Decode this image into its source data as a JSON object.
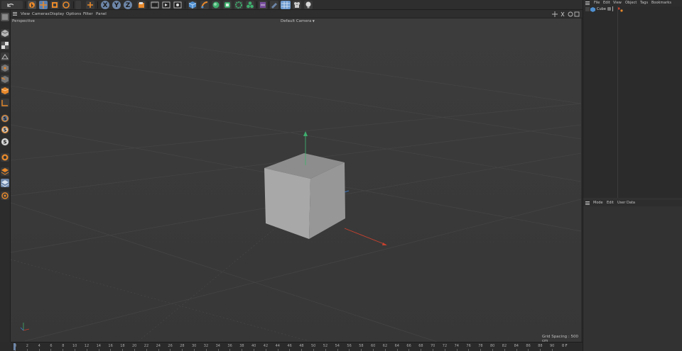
{
  "colors": {
    "accent_orange": "#e8892b",
    "axis_x": "#c8412e",
    "axis_y": "#3fae6e",
    "axis_z": "#3b7bd4",
    "cube_front": "#a8a8a8",
    "cube_top": "#8d8d8d",
    "cube_right": "#979797"
  },
  "toolbar": {
    "icons": [
      "undo-icon",
      "live-select-icon",
      "move-icon",
      "scale-icon",
      "rotate-icon",
      "add-icon",
      "x-axis-lock-icon",
      "y-axis-lock-icon",
      "z-axis-lock-icon",
      "world-coords-icon",
      "render-region-icon",
      "render-view-icon",
      "render-settings-icon",
      "cube-icon",
      "pen-icon",
      "subdivision-icon",
      "array-icon",
      "deformer-icon",
      "mograph-icon",
      "sky-icon",
      "camera-icon",
      "floor-icon",
      "render-pot-icon",
      "light-icon"
    ],
    "xyz": [
      "X",
      "Y",
      "Z"
    ]
  },
  "viewport": {
    "menus": [
      "View",
      "Cameras",
      "Display",
      "Options",
      "Filter",
      "Panel"
    ],
    "view_name": "Perspective",
    "camera": "Default Camera",
    "grid_spacing": "Grid Spacing : 500 cm"
  },
  "timeline": {
    "ticks": [
      "0",
      "2",
      "4",
      "6",
      "8",
      "10",
      "12",
      "14",
      "16",
      "18",
      "20",
      "22",
      "24",
      "26",
      "28",
      "30",
      "32",
      "34",
      "36",
      "38",
      "40",
      "42",
      "44",
      "46",
      "48",
      "50",
      "52",
      "54",
      "56",
      "58",
      "60",
      "62",
      "64",
      "66",
      "68",
      "70",
      "72",
      "74",
      "76",
      "78",
      "80",
      "82",
      "84",
      "86",
      "88",
      "90"
    ],
    "current_frame": "0 F"
  },
  "object_manager": {
    "menus": [
      "File",
      "Edit",
      "View",
      "Object",
      "Tags",
      "Bookmarks"
    ],
    "objects": [
      {
        "name": "Cube"
      }
    ]
  },
  "attribute_manager": {
    "menus": [
      "Mode",
      "Edit",
      "User Data"
    ]
  }
}
